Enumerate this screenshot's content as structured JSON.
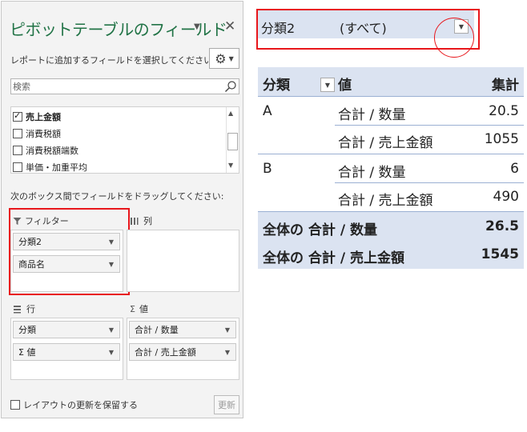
{
  "pane": {
    "title": "ピボットテーブルのフィールド",
    "choose_label": "レポートに追加するフィールドを選択してください:",
    "search_placeholder": "検索",
    "fields": [
      {
        "label": "売上金額",
        "checked": true
      },
      {
        "label": "消費税額",
        "checked": false
      },
      {
        "label": "消費税額端数",
        "checked": false
      },
      {
        "label": "単価・加重平均",
        "checked": false
      }
    ],
    "drag_label": "次のボックス間でフィールドをドラッグしてください:",
    "areas": {
      "filter": {
        "title": "フィルター",
        "items": [
          "分類2",
          "商品名"
        ]
      },
      "columns": {
        "title": "列",
        "items": []
      },
      "rows": {
        "title": "行",
        "items": [
          "分類",
          "Σ 値"
        ]
      },
      "values": {
        "title": "値",
        "items": [
          "合計 / 数量",
          "合計 / 売上金額"
        ]
      }
    },
    "defer_label": "レイアウトの更新を保留する",
    "update_label": "更新"
  },
  "pivot": {
    "filter_label": "分類2",
    "filter_value": "(すべて)",
    "headers": [
      "分類",
      "値",
      "集計"
    ],
    "rows": [
      {
        "group": "A",
        "measure": "合計 / 数量",
        "value": "20.5"
      },
      {
        "group": "",
        "measure": "合計 / 売上金額",
        "value": "1055"
      },
      {
        "group": "B",
        "measure": "合計 / 数量",
        "value": "6"
      },
      {
        "group": "",
        "measure": "合計 / 売上金額",
        "value": "490"
      }
    ],
    "totals": [
      {
        "label": "全体の 合計 / 数量",
        "value": "26.5"
      },
      {
        "label": "全体の 合計 / 売上金額",
        "value": "1545"
      }
    ]
  },
  "colors": {
    "title_green": "#217346",
    "highlight_red": "#e8161b",
    "pivot_band": "#dbe3f1"
  },
  "icons": {
    "menu": "chevron-down-icon",
    "close": "close-icon",
    "settings": "gear-icon",
    "search": "search-icon",
    "filter": "funnel-icon",
    "columns": "columns-icon",
    "rows": "rows-icon",
    "values": "sigma-icon"
  }
}
